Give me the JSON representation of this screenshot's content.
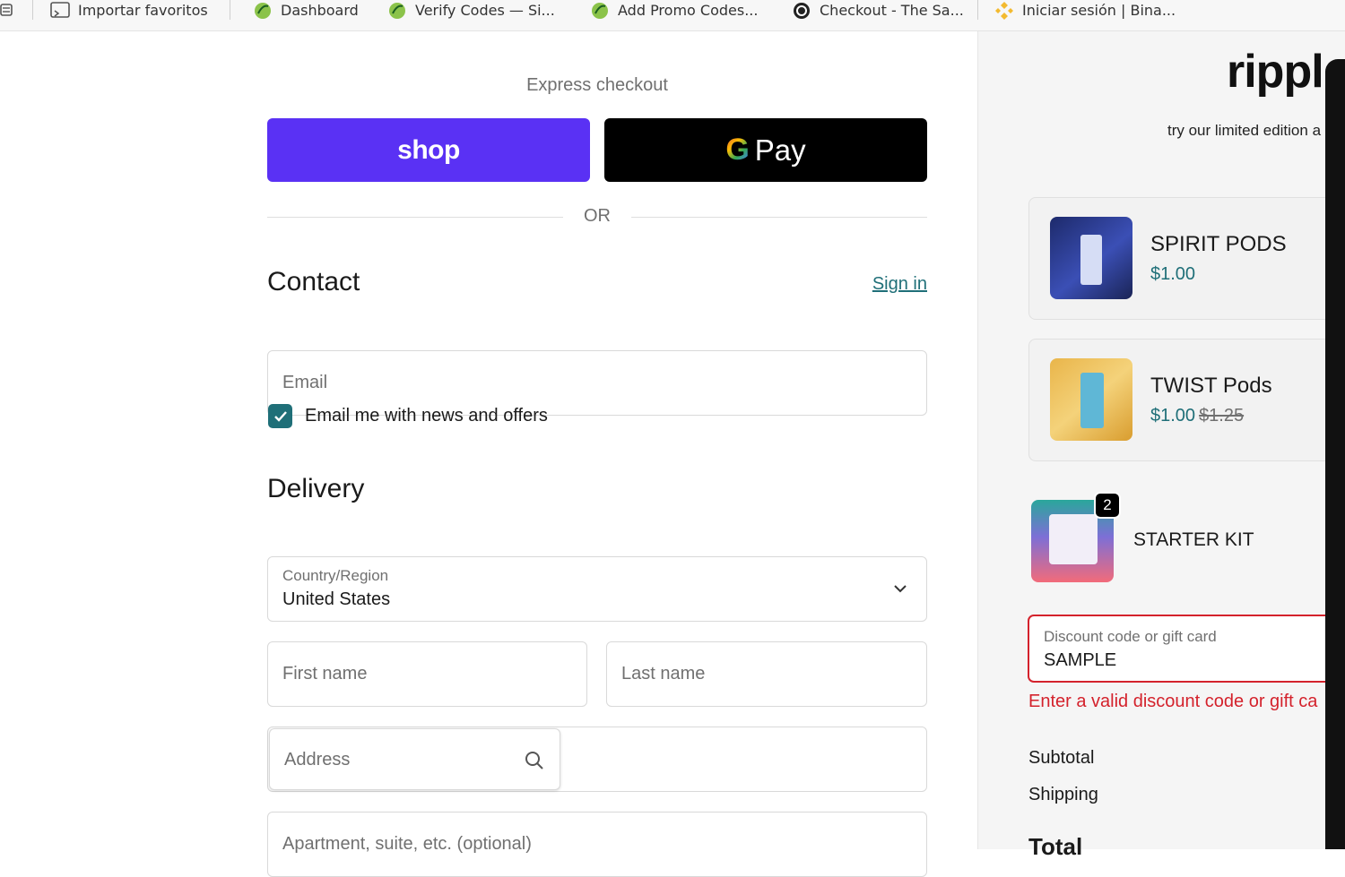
{
  "bookmarks": [
    {
      "label": "Importar favoritos",
      "icon": "import-icon"
    },
    {
      "label": "Dashboard",
      "icon": "leaf-icon"
    },
    {
      "label": "Verify Codes — Si...",
      "icon": "leaf-icon"
    },
    {
      "label": "Add Promo Codes...",
      "icon": "leaf-icon"
    },
    {
      "label": "Checkout - The Sa...",
      "icon": "site-icon"
    },
    {
      "label": "Iniciar sesión | Bina...",
      "icon": "binance-icon"
    }
  ],
  "checkout": {
    "express_label": "Express checkout",
    "shop_label": "shop",
    "gpay_g": "G",
    "gpay_label": "Pay",
    "or_label": "OR",
    "contact_title": "Contact",
    "signin_label": "Sign in",
    "email_placeholder": "Email",
    "news_checkbox_label": "Email me with news and offers",
    "news_checked": true,
    "delivery_title": "Delivery",
    "country_label": "Country/Region",
    "country_value": "United States",
    "first_name_placeholder": "First name",
    "last_name_placeholder": "Last name",
    "address_placeholder": "Address",
    "apartment_placeholder": "Apartment, suite, etc. (optional)"
  },
  "summary": {
    "logo_text": "rippl",
    "promo_text": "try our limited edition a",
    "items": [
      {
        "name": "SPIRIT PODS",
        "price": "$1.00",
        "old_price": ""
      },
      {
        "name": "TWIST Pods",
        "price": "$1.00",
        "old_price": "$1.25"
      },
      {
        "name": "STARTER KIT",
        "price": "",
        "old_price": "",
        "quantity": "2"
      }
    ],
    "discount_label": "Discount code or gift card",
    "discount_value": "SAMPLE",
    "discount_error": "Enter a valid discount code or gift ca",
    "subtotal_label": "Subtotal",
    "shipping_label": "Shipping",
    "total_label": "Total"
  },
  "colors": {
    "shop": "#5a31f4",
    "link": "#1f6f78",
    "error": "#d4222c"
  }
}
